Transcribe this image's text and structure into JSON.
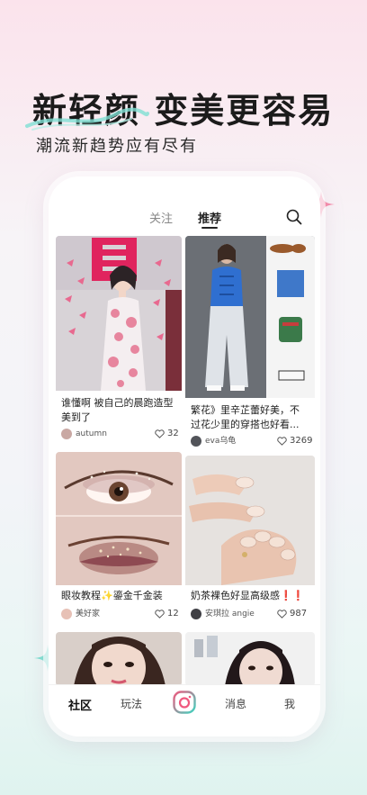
{
  "promo": {
    "headline": "新轻颜 变美更容易",
    "subheadline": "潮流新趋势应有尽有"
  },
  "top_nav": {
    "tabs": [
      {
        "label": "关注",
        "active": false
      },
      {
        "label": "推荐",
        "active": true
      }
    ],
    "search_icon": "search-icon"
  },
  "feed": {
    "cards": [
      {
        "title": "谁懂啊 被自己的晨跑造型美到了",
        "author": "autumn",
        "likes": "32"
      },
      {
        "title": "繁花》里辛芷蕾好美，不过花少里的穿搭也好看...",
        "author": "eva乌龟",
        "likes": "3269"
      },
      {
        "title": "眼妆教程✨鎏金千金装",
        "author": "美好家",
        "likes": "12"
      },
      {
        "title": "奶茶裸色好显高级感❗❗",
        "author": "安琪拉 angie",
        "likes": "987"
      }
    ]
  },
  "bottom_nav": {
    "items": [
      {
        "label": "社区",
        "active": true
      },
      {
        "label": "玩法",
        "active": false
      },
      {
        "label": "消息",
        "active": false
      },
      {
        "label": "我",
        "active": false
      }
    ],
    "camera_icon": "camera-icon"
  },
  "colors": {
    "accent_pink": "#f0587e",
    "accent_teal": "#3fd4c0",
    "background_top": "#fbe3ec",
    "background_bottom": "#dff3ef"
  }
}
